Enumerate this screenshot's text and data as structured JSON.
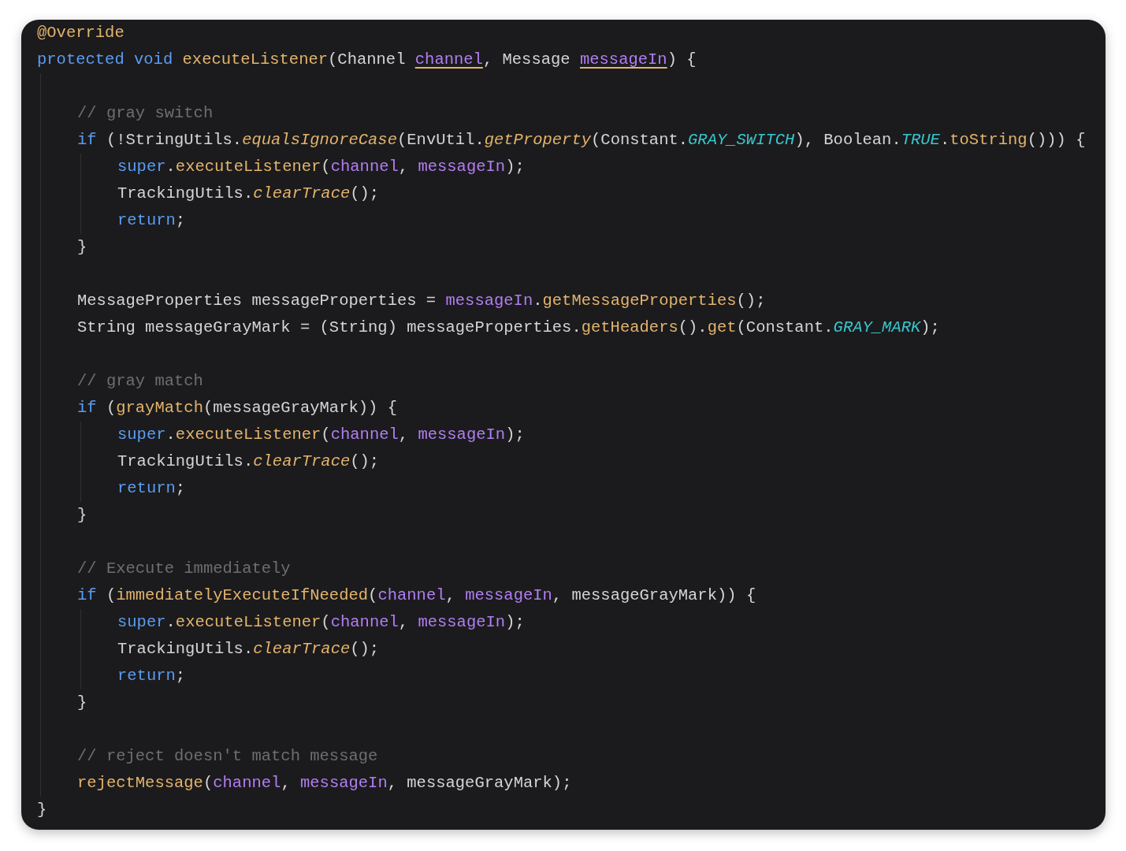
{
  "editor": {
    "lines": [
      {
        "kind": "code",
        "tokens": [
          {
            "text": "@Override",
            "kind": "annotation"
          }
        ]
      },
      {
        "kind": "code",
        "tokens": [
          {
            "text": "protected void ",
            "kind": "keyword"
          },
          {
            "text": "executeListener",
            "kind": "method"
          },
          {
            "text": "(Channel ",
            "kind": "plain"
          },
          {
            "text": "channel",
            "kind": "param_declared"
          },
          {
            "text": ", Message ",
            "kind": "plain"
          },
          {
            "text": "messageIn",
            "kind": "param_declared"
          },
          {
            "text": ") {",
            "kind": "plain"
          }
        ],
        "children": [
          {
            "kind": "blank"
          },
          {
            "kind": "code",
            "tokens": [
              {
                "text": "// gray switch",
                "kind": "comment"
              }
            ]
          },
          {
            "kind": "code",
            "tokens": [
              {
                "text": "if ",
                "kind": "keyword"
              },
              {
                "text": "(!StringUtils.",
                "kind": "plain"
              },
              {
                "text": "equalsIgnoreCase",
                "kind": "method_italic"
              },
              {
                "text": "(EnvUtil.",
                "kind": "plain"
              },
              {
                "text": "getProperty",
                "kind": "method_italic"
              },
              {
                "text": "(Constant.",
                "kind": "plain"
              },
              {
                "text": "GRAY_SWITCH",
                "kind": "constant"
              },
              {
                "text": "), Boolean.",
                "kind": "plain"
              },
              {
                "text": "TRUE",
                "kind": "constant"
              },
              {
                "text": ".",
                "kind": "plain"
              },
              {
                "text": "toString",
                "kind": "method"
              },
              {
                "text": "())) {",
                "kind": "plain"
              }
            ],
            "children": [
              {
                "kind": "code",
                "tokens": [
                  {
                    "text": "super",
                    "kind": "keyword"
                  },
                  {
                    "text": ".",
                    "kind": "plain"
                  },
                  {
                    "text": "executeListener",
                    "kind": "method"
                  },
                  {
                    "text": "(",
                    "kind": "plain"
                  },
                  {
                    "text": "channel",
                    "kind": "param"
                  },
                  {
                    "text": ", ",
                    "kind": "plain"
                  },
                  {
                    "text": "messageIn",
                    "kind": "param"
                  },
                  {
                    "text": ");",
                    "kind": "plain"
                  }
                ]
              },
              {
                "kind": "code",
                "tokens": [
                  {
                    "text": "TrackingUtils.",
                    "kind": "plain"
                  },
                  {
                    "text": "clearTrace",
                    "kind": "method_italic"
                  },
                  {
                    "text": "();",
                    "kind": "plain"
                  }
                ]
              },
              {
                "kind": "code",
                "tokens": [
                  {
                    "text": "return",
                    "kind": "keyword"
                  },
                  {
                    "text": ";",
                    "kind": "plain"
                  }
                ]
              }
            ]
          },
          {
            "kind": "code",
            "tokens": [
              {
                "text": "}",
                "kind": "plain"
              }
            ]
          },
          {
            "kind": "blank"
          },
          {
            "kind": "code",
            "tokens": [
              {
                "text": "MessageProperties messageProperties = ",
                "kind": "plain"
              },
              {
                "text": "messageIn",
                "kind": "param"
              },
              {
                "text": ".",
                "kind": "plain"
              },
              {
                "text": "getMessageProperties",
                "kind": "method"
              },
              {
                "text": "();",
                "kind": "plain"
              }
            ]
          },
          {
            "kind": "code",
            "tokens": [
              {
                "text": "String messageGrayMark = (String) messageProperties.",
                "kind": "plain"
              },
              {
                "text": "getHeaders",
                "kind": "method"
              },
              {
                "text": "().",
                "kind": "plain"
              },
              {
                "text": "get",
                "kind": "method"
              },
              {
                "text": "(Constant.",
                "kind": "plain"
              },
              {
                "text": "GRAY_MARK",
                "kind": "constant"
              },
              {
                "text": ");",
                "kind": "plain"
              }
            ]
          },
          {
            "kind": "blank"
          },
          {
            "kind": "code",
            "tokens": [
              {
                "text": "// gray match",
                "kind": "comment"
              }
            ]
          },
          {
            "kind": "code",
            "tokens": [
              {
                "text": "if ",
                "kind": "keyword"
              },
              {
                "text": "(",
                "kind": "plain"
              },
              {
                "text": "grayMatch",
                "kind": "method"
              },
              {
                "text": "(messageGrayMark)) {",
                "kind": "plain"
              }
            ],
            "children": [
              {
                "kind": "code",
                "tokens": [
                  {
                    "text": "super",
                    "kind": "keyword"
                  },
                  {
                    "text": ".",
                    "kind": "plain"
                  },
                  {
                    "text": "executeListener",
                    "kind": "method"
                  },
                  {
                    "text": "(",
                    "kind": "plain"
                  },
                  {
                    "text": "channel",
                    "kind": "param"
                  },
                  {
                    "text": ", ",
                    "kind": "plain"
                  },
                  {
                    "text": "messageIn",
                    "kind": "param"
                  },
                  {
                    "text": ");",
                    "kind": "plain"
                  }
                ]
              },
              {
                "kind": "code",
                "tokens": [
                  {
                    "text": "TrackingUtils.",
                    "kind": "plain"
                  },
                  {
                    "text": "clearTrace",
                    "kind": "method_italic"
                  },
                  {
                    "text": "();",
                    "kind": "plain"
                  }
                ]
              },
              {
                "kind": "code",
                "tokens": [
                  {
                    "text": "return",
                    "kind": "keyword"
                  },
                  {
                    "text": ";",
                    "kind": "plain"
                  }
                ]
              }
            ]
          },
          {
            "kind": "code",
            "tokens": [
              {
                "text": "}",
                "kind": "plain"
              }
            ]
          },
          {
            "kind": "blank"
          },
          {
            "kind": "code",
            "tokens": [
              {
                "text": "// Execute immediately",
                "kind": "comment"
              }
            ]
          },
          {
            "kind": "code",
            "tokens": [
              {
                "text": "if ",
                "kind": "keyword"
              },
              {
                "text": "(",
                "kind": "plain"
              },
              {
                "text": "immediatelyExecuteIfNeeded",
                "kind": "method"
              },
              {
                "text": "(",
                "kind": "plain"
              },
              {
                "text": "channel",
                "kind": "param"
              },
              {
                "text": ", ",
                "kind": "plain"
              },
              {
                "text": "messageIn",
                "kind": "param"
              },
              {
                "text": ", messageGrayMark)) {",
                "kind": "plain"
              }
            ],
            "children": [
              {
                "kind": "code",
                "tokens": [
                  {
                    "text": "super",
                    "kind": "keyword"
                  },
                  {
                    "text": ".",
                    "kind": "plain"
                  },
                  {
                    "text": "executeListener",
                    "kind": "method"
                  },
                  {
                    "text": "(",
                    "kind": "plain"
                  },
                  {
                    "text": "channel",
                    "kind": "param"
                  },
                  {
                    "text": ", ",
                    "kind": "plain"
                  },
                  {
                    "text": "messageIn",
                    "kind": "param"
                  },
                  {
                    "text": ");",
                    "kind": "plain"
                  }
                ]
              },
              {
                "kind": "code",
                "tokens": [
                  {
                    "text": "TrackingUtils.",
                    "kind": "plain"
                  },
                  {
                    "text": "clearTrace",
                    "kind": "method_italic"
                  },
                  {
                    "text": "();",
                    "kind": "plain"
                  }
                ]
              },
              {
                "kind": "code",
                "tokens": [
                  {
                    "text": "return",
                    "kind": "keyword"
                  },
                  {
                    "text": ";",
                    "kind": "plain"
                  }
                ]
              }
            ]
          },
          {
            "kind": "code",
            "tokens": [
              {
                "text": "}",
                "kind": "plain"
              }
            ]
          },
          {
            "kind": "blank"
          },
          {
            "kind": "code",
            "tokens": [
              {
                "text": "// reject doesn't match message",
                "kind": "comment"
              }
            ]
          },
          {
            "kind": "code",
            "tokens": [
              {
                "text": "rejectMessage",
                "kind": "method"
              },
              {
                "text": "(",
                "kind": "plain"
              },
              {
                "text": "channel",
                "kind": "param"
              },
              {
                "text": ", ",
                "kind": "plain"
              },
              {
                "text": "messageIn",
                "kind": "param"
              },
              {
                "text": ", messageGrayMark);",
                "kind": "plain"
              }
            ]
          }
        ]
      },
      {
        "kind": "code",
        "tokens": [
          {
            "text": "}",
            "kind": "plain"
          }
        ]
      }
    ]
  }
}
